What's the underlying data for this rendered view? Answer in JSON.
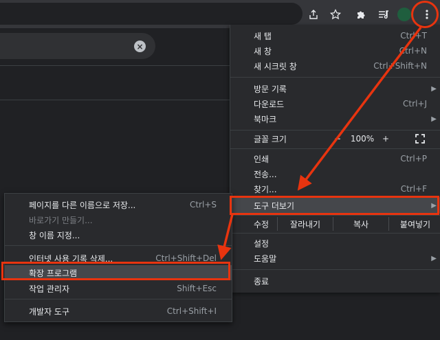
{
  "toolbar": {
    "icons": [
      "share-icon",
      "star-icon",
      "puzzle-icon",
      "reading-list-icon",
      "avatar",
      "menu-dots-icon"
    ]
  },
  "main_menu": {
    "new_tab": {
      "label": "새 탭",
      "shortcut": "Ctrl+T"
    },
    "new_window": {
      "label": "새 창",
      "shortcut": "Ctrl+N"
    },
    "new_incognito": {
      "label": "새 시크릿 창",
      "shortcut": "Ctrl+Shift+N"
    },
    "history": {
      "label": "방문 기록"
    },
    "downloads": {
      "label": "다운로드",
      "shortcut": "Ctrl+J"
    },
    "bookmarks": {
      "label": "북마크"
    },
    "zoom": {
      "label": "글꼴 크기",
      "minus": "−",
      "value": "100%",
      "plus": "+"
    },
    "print": {
      "label": "인쇄",
      "shortcut": "Ctrl+P"
    },
    "cast": {
      "label": "전송..."
    },
    "find": {
      "label": "찾기...",
      "shortcut": "Ctrl+F"
    },
    "more_tools": {
      "label": "도구 더보기"
    },
    "edit": {
      "label": "수정",
      "cut": "잘라내기",
      "copy": "복사",
      "paste": "붙여넣기"
    },
    "settings": {
      "label": "설정"
    },
    "help": {
      "label": "도움말"
    },
    "exit": {
      "label": "종료"
    }
  },
  "sub_menu": {
    "save_page": {
      "label": "페이지를 다른 이름으로 저장...",
      "shortcut": "Ctrl+S"
    },
    "create_shortcut": {
      "label": "바로가기 만들기..."
    },
    "name_window": {
      "label": "창 이름 지정..."
    },
    "clear_data": {
      "label": "인터넷 사용 기록 삭제...",
      "shortcut": "Ctrl+Shift+Del"
    },
    "extensions": {
      "label": "확장 프로그램"
    },
    "task_manager": {
      "label": "작업 관리자",
      "shortcut": "Shift+Esc"
    },
    "dev_tools": {
      "label": "개발자 도구",
      "shortcut": "Ctrl+Shift+I"
    }
  },
  "colors": {
    "highlight": "#e8340f",
    "menu_bg": "#292a2d",
    "toolbar_bg": "#35363a"
  }
}
